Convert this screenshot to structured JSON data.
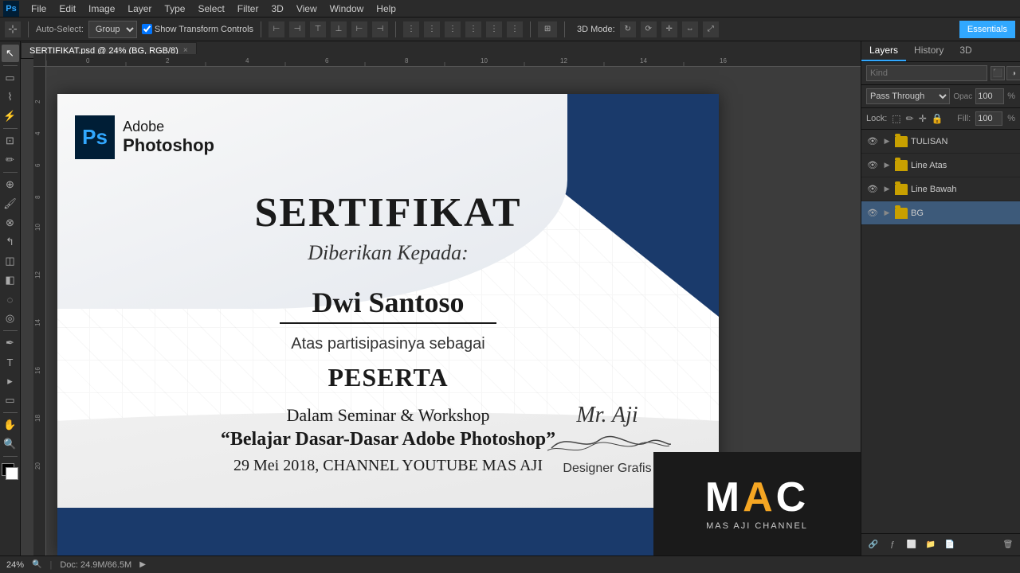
{
  "app": {
    "title": "Adobe Photoshop",
    "logo": "Ps"
  },
  "menubar": {
    "items": [
      "Ps",
      "File",
      "Edit",
      "Image",
      "Layer",
      "Type",
      "Select",
      "Filter",
      "3D",
      "View",
      "Window",
      "Help"
    ]
  },
  "optionsbar": {
    "tool_label": "Auto-Select:",
    "group_select": "Group",
    "show_transform": "Show Transform Controls",
    "mode_label": "3D Mode:",
    "essential_label": "Essentials"
  },
  "document": {
    "tab_label": "SERTIFIKAT.psd @ 24% (BG, RGB/8)",
    "close_btn": "×"
  },
  "certificate": {
    "title": "SERTIFIKAT",
    "subtitle": "Diberikan Kepada:",
    "name": "Dwi Santoso",
    "atas": "Atas partisipasinya sebagai",
    "role": "PESERTA",
    "dalam": "Dalam Seminar & Workshop",
    "workshop": "“Belajar Dasar-Dasar Adobe Photoshop”",
    "date": "29 Mei 2018, CHANNEL YOUTUBE MAS AJI",
    "sig_name": "Mr. Aji",
    "sig_title": "Designer Grafis",
    "logo_ps": "Ps",
    "logo_line1": "Adobe",
    "logo_line2": "Photoshop"
  },
  "layers_panel": {
    "tabs": [
      "Layers",
      "History",
      "3D"
    ],
    "search_placeholder": "Kind",
    "blend_mode": "Pass Through",
    "opacity_label": "Opac",
    "lock_label": "Lock:",
    "layers": [
      {
        "name": "TULISAN",
        "type": "folder",
        "visible": true,
        "expanded": true
      },
      {
        "name": "Line Atas",
        "type": "folder",
        "visible": true,
        "expanded": true
      },
      {
        "name": "Line Bawah",
        "type": "folder",
        "visible": true,
        "expanded": true
      },
      {
        "name": "BG",
        "type": "folder",
        "visible": true,
        "expanded": false,
        "active": true
      }
    ]
  },
  "statusbar": {
    "zoom": "24%",
    "doc_size": "Doc: 24.9M/66.5M"
  },
  "mac_channel": {
    "logo_m": "M",
    "logo_a": "A",
    "logo_c": "C",
    "subtitle": "MAS AJI CHANNEL"
  }
}
